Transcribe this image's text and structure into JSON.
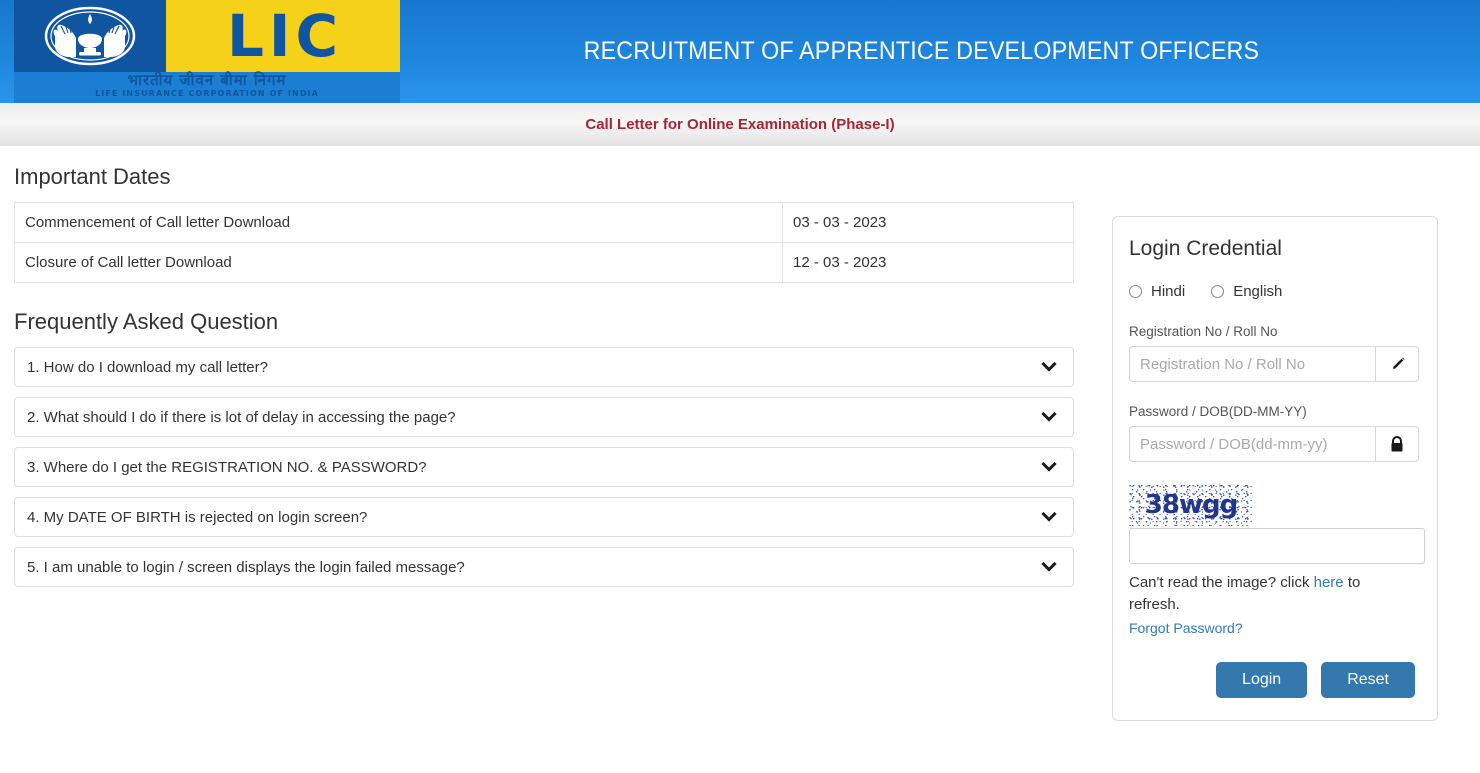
{
  "header": {
    "logo": {
      "brand": "LIC",
      "hindi_line": "भारतीय जीवन बीमा निगम",
      "english_line": "LIFE INSURANCE CORPORATION OF INDIA"
    },
    "title": "RECRUITMENT OF APPRENTICE DEVELOPMENT OFFICERS"
  },
  "subtitle": "Call Letter for Online Examination (Phase-I)",
  "important_dates": {
    "heading": "Important Dates",
    "rows": [
      {
        "label": "Commencement of Call letter Download",
        "date": "03 - 03 - 2023"
      },
      {
        "label": "Closure of Call letter Download",
        "date": "12 - 03 - 2023"
      }
    ]
  },
  "faq": {
    "heading": "Frequently Asked Question",
    "items": [
      {
        "question": "1. How do I download my call letter?"
      },
      {
        "question": "2. What should I do if there is lot of delay in accessing the page?"
      },
      {
        "question": "3. Where do I get the REGISTRATION NO. & PASSWORD?"
      },
      {
        "question": "4. My DATE OF BIRTH is rejected on login screen?"
      },
      {
        "question": "5. I am unable to login / screen displays the login failed message?"
      }
    ]
  },
  "login": {
    "title": "Login Credential",
    "language_options": [
      {
        "label": "Hindi",
        "selected": false
      },
      {
        "label": "English",
        "selected": false
      }
    ],
    "registration": {
      "label": "Registration No / Roll No",
      "placeholder": "Registration No / Roll No",
      "value": "",
      "icon": "pencil-icon"
    },
    "password": {
      "label": "Password / DOB(DD-MM-YY)",
      "placeholder": "Password / DOB(dd-mm-yy)",
      "value": "",
      "icon": "lock-icon"
    },
    "captcha": {
      "text": "38wgg",
      "input_value": "",
      "refresh_prefix": "Can't read the image? click ",
      "refresh_link": "here",
      "refresh_suffix": " to refresh."
    },
    "forgot_password": "Forgot Password?",
    "buttons": {
      "login": "Login",
      "reset": "Reset"
    }
  },
  "colors": {
    "header_blue": "#1e85dd",
    "logo_blue": "#10559f",
    "logo_yellow": "#f6d119",
    "subtitle_red": "#a62633",
    "button_blue": "#3479ae",
    "link_blue": "#337ab7",
    "captcha_navy": "#21358c"
  }
}
